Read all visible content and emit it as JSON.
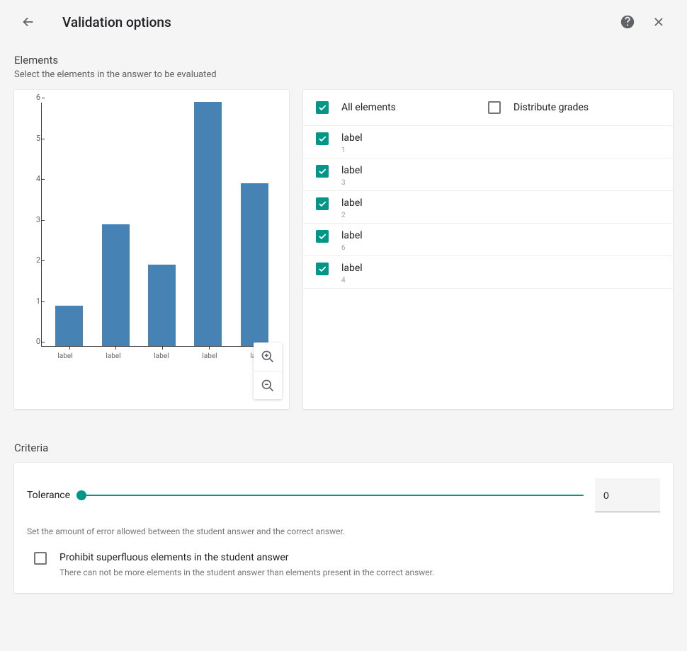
{
  "header": {
    "title": "Validation options"
  },
  "elements": {
    "heading": "Elements",
    "sub": "Select the elements in the answer to be evaluated",
    "all_label": "All elements",
    "distribute_label": "Distribute grades",
    "items": [
      {
        "label": "label",
        "sub": "1"
      },
      {
        "label": "label",
        "sub": "3"
      },
      {
        "label": "label",
        "sub": "2"
      },
      {
        "label": "label",
        "sub": "6"
      },
      {
        "label": "label",
        "sub": "4"
      }
    ]
  },
  "criteria": {
    "heading": "Criteria",
    "tolerance_label": "Tolerance",
    "tolerance_value": "0",
    "tolerance_note": "Set the amount of error allowed between the student answer and the correct answer.",
    "prohibit_label": "Prohibit superfluous elements in the student answer",
    "prohibit_sub": "There can not be more elements in the student answer than elements present in the correct answer."
  },
  "chart_data": {
    "type": "bar",
    "categories": [
      "label",
      "label",
      "label",
      "label",
      "label"
    ],
    "values": [
      1,
      3,
      2,
      6,
      4
    ],
    "title": "",
    "xlabel": "",
    "ylabel": "",
    "ylim": [
      0,
      6
    ],
    "yticks": [
      0,
      1,
      2,
      3,
      4,
      5,
      6
    ]
  }
}
